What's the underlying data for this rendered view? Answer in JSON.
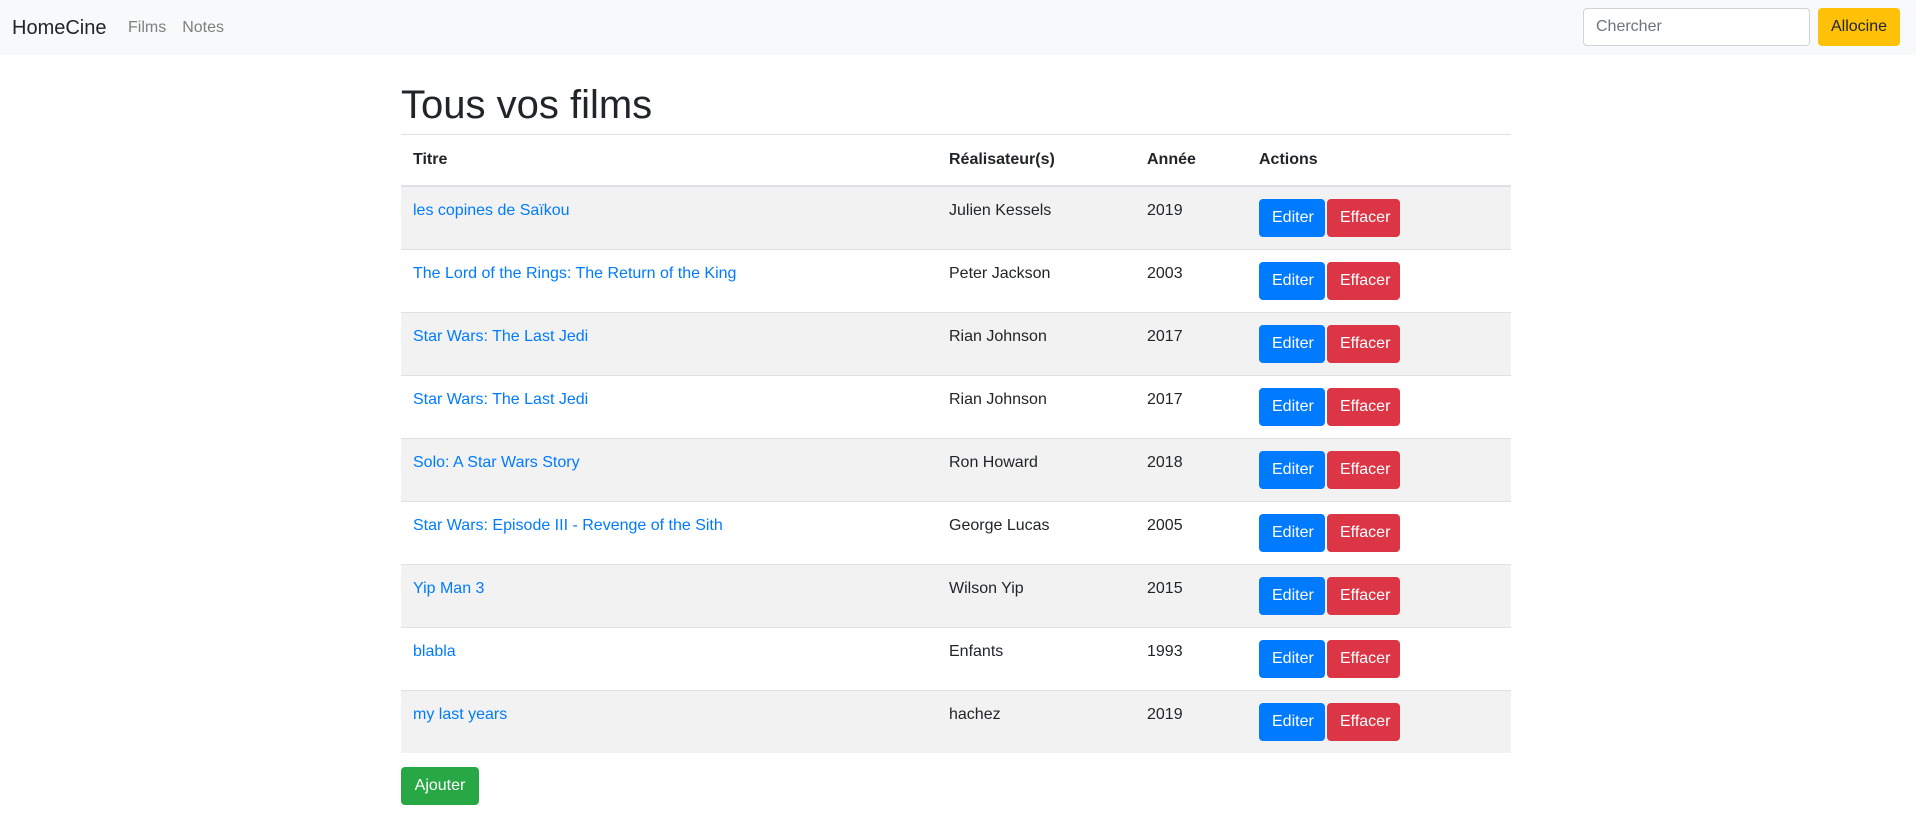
{
  "navbar": {
    "brand": "HomeCine",
    "links": [
      "Films",
      "Notes"
    ],
    "search_placeholder": "Chercher",
    "search_value": "",
    "allocine_label": "Allocine"
  },
  "main": {
    "title": "Tous vos films",
    "table": {
      "headers": [
        "Titre",
        "Réalisateur(s)",
        "Année",
        "Actions"
      ],
      "rows": [
        {
          "title": "les copines de Saïkou",
          "director": "Julien Kessels",
          "year": "2019"
        },
        {
          "title": "The Lord of the Rings: The Return of the King",
          "director": "Peter Jackson",
          "year": "2003"
        },
        {
          "title": "Star Wars: The Last Jedi",
          "director": "Rian Johnson",
          "year": "2017"
        },
        {
          "title": "Star Wars: The Last Jedi",
          "director": "Rian Johnson",
          "year": "2017"
        },
        {
          "title": "Solo: A Star Wars Story",
          "director": "Ron Howard",
          "year": "2018"
        },
        {
          "title": "Star Wars: Episode III - Revenge of the Sith",
          "director": "George Lucas",
          "year": "2005"
        },
        {
          "title": "Yip Man 3",
          "director": "Wilson Yip",
          "year": "2015"
        },
        {
          "title": "blabla",
          "director": "Enfants",
          "year": "1993"
        },
        {
          "title": "my last years",
          "director": "hachez",
          "year": "2019"
        }
      ],
      "edit_label": "Editer",
      "delete_label": "Effacer"
    },
    "add_label": "Ajouter"
  },
  "colors": {
    "primary": "#007bff",
    "danger": "#dc3545",
    "success": "#28a745",
    "warning": "#ffc107",
    "navbar_bg": "#f8f9fa",
    "stripe": "#f2f2f2"
  }
}
